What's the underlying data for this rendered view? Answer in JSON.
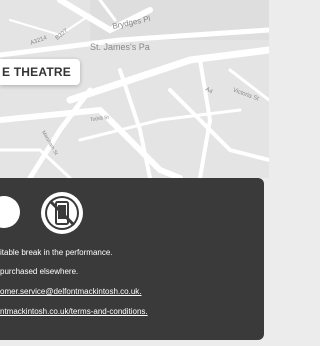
{
  "map": {
    "labels": {
      "st_james": "St. James's Pa",
      "brydges": "Brydges Pl",
      "road_a": "A3214",
      "road_b": "B327",
      "road_c": "A4",
      "road_d": "Victoria St",
      "road_e": "Tothill St",
      "road_f": "Marsham St"
    },
    "pin_label": "E THEATRE"
  },
  "info_panel": {
    "background": "#3a3a3a",
    "icon": "no-mobile-phone-icon",
    "lines": {
      "interval": "itable break in the performance.",
      "purchased": "purchased elsewhere.",
      "email": "omer.service@delfontmackintosh.co.uk.",
      "terms": "ntmackintosh.co.uk/terms-and-conditions."
    }
  }
}
